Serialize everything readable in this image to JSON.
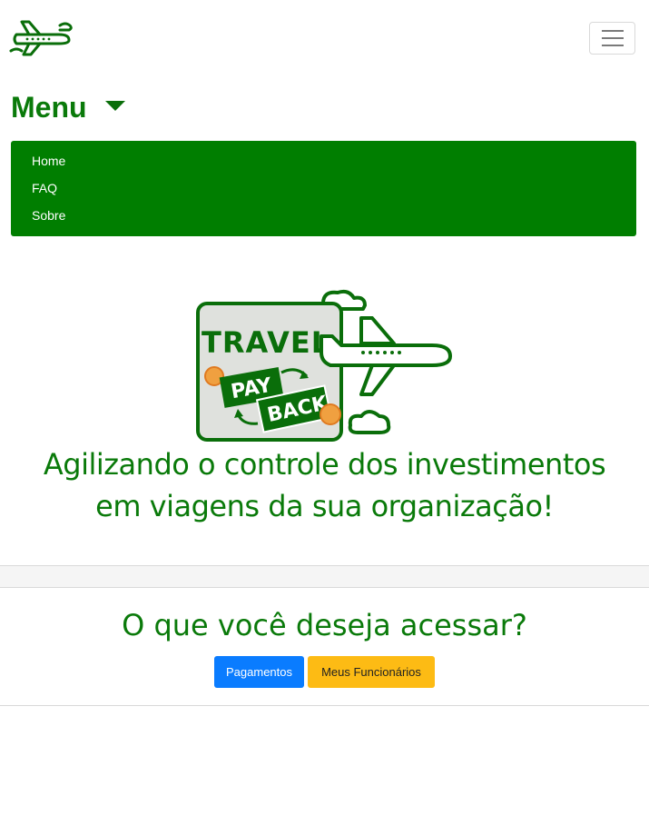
{
  "nav": {
    "brand_icon": "airplane-icon",
    "toggle_icon": "hamburger-icon"
  },
  "menu": {
    "title": "Menu",
    "items": [
      {
        "label": "Home"
      },
      {
        "label": "FAQ"
      },
      {
        "label": "Sobre"
      }
    ]
  },
  "logo": {
    "word1": "TRAVEL",
    "word2": "PAY",
    "word3": "BACK"
  },
  "hero": {
    "line1": "Agilizando o controle dos investimentos",
    "line2": "em viagens da sua organização!"
  },
  "access": {
    "question": "O que você deseja acessar?",
    "buttons": [
      {
        "label": "Pagamentos"
      },
      {
        "label": "Meus Funcionários"
      }
    ]
  },
  "colors": {
    "brand_green": "#007e00",
    "text_green": "#0a7a0a",
    "primary_blue": "#0a7cff",
    "warning_yellow": "#fdbb14"
  }
}
